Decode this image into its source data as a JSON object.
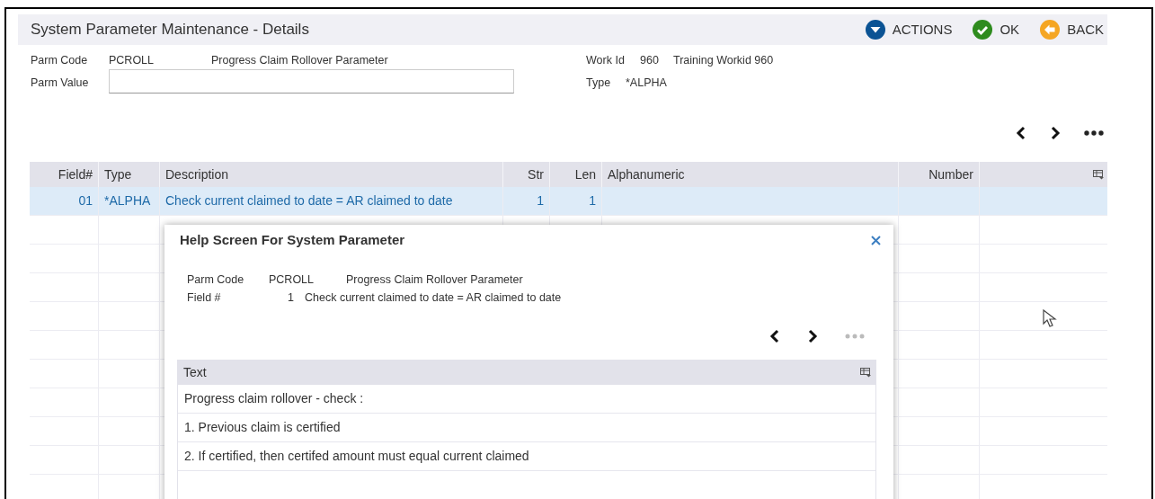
{
  "header": {
    "title": "System Parameter Maintenance - Details",
    "actions": [
      {
        "kind": "actions",
        "label": "ACTIONS"
      },
      {
        "kind": "ok",
        "label": "OK"
      },
      {
        "kind": "back",
        "label": "BACK"
      }
    ]
  },
  "info": {
    "parm_code_label": "Parm Code",
    "parm_code": "PCROLL",
    "parm_desc": "Progress Claim Rollover Parameter",
    "parm_value_label": "Parm Value",
    "work_id_label": "Work Id",
    "work_id": "960",
    "work_id_desc": "Training Workid 960",
    "type_label": "Type",
    "type": "*ALPHA"
  },
  "table": {
    "columns": [
      "Field#",
      "Type",
      "Description",
      "Str",
      "Len",
      "Alphanumeric",
      "Number"
    ],
    "rows": [
      {
        "selected": true,
        "cells": [
          "01",
          "*ALPHA",
          "Check current claimed to date = AR claimed to date",
          "1",
          "1",
          "",
          ""
        ]
      }
    ]
  },
  "dialog": {
    "title": "Help Screen For System Parameter",
    "parm_code_label": "Parm Code",
    "parm_code": "PCROLL",
    "parm_desc": "Progress Claim Rollover Parameter",
    "field_label": "Field #",
    "field_no": "1",
    "field_desc": "Check current claimed to date = AR claimed to date",
    "text_column": "Text",
    "lines": [
      "Progress claim rollover - check :",
      "1. Previous claim is certified",
      "2. If certified, then certifed amount must equal current claimed"
    ]
  }
}
